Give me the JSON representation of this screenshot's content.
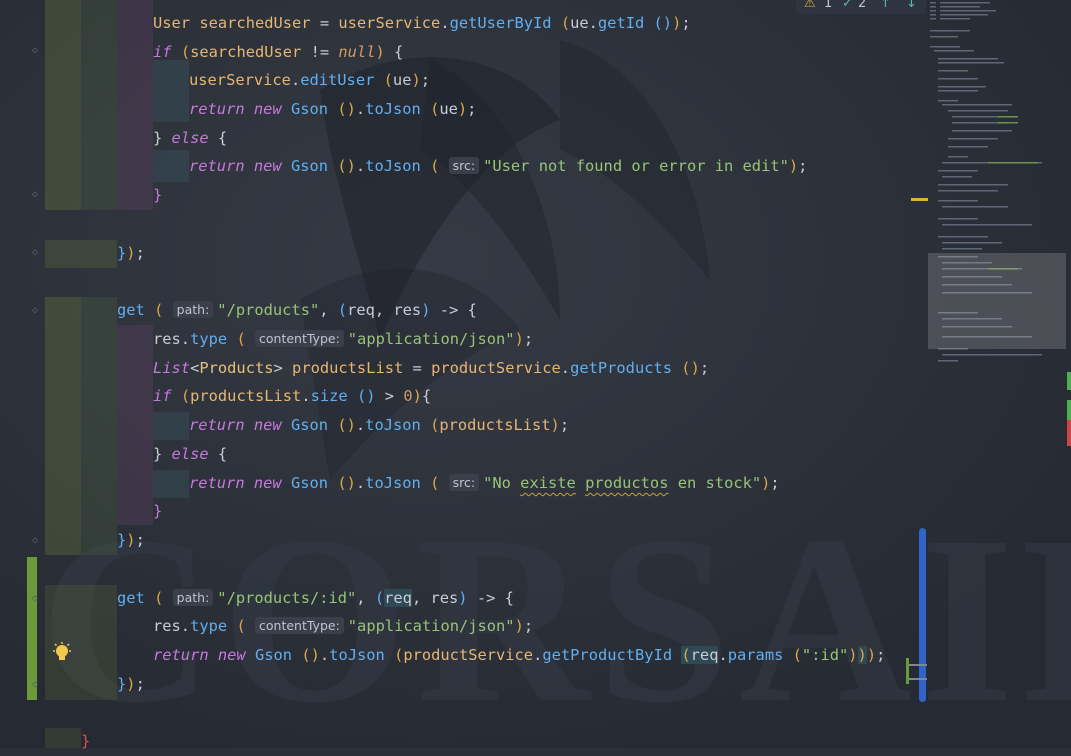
{
  "editor": {
    "inspections": {
      "warnings_count": "1",
      "weak_warnings_count": "2"
    },
    "lines": [
      {
        "tokens": [
          [
            "var",
            "User"
          ],
          [
            "p",
            " "
          ],
          [
            "var",
            "searchedUser"
          ],
          [
            "p",
            " = "
          ],
          [
            "var",
            "userService"
          ],
          [
            "p",
            "."
          ],
          [
            "fn",
            "getUserById"
          ],
          [
            "p",
            " "
          ],
          [
            "bp",
            "("
          ],
          [
            "p",
            "ue."
          ],
          [
            "fn",
            "getId"
          ],
          [
            "p",
            " "
          ],
          [
            "bb",
            "()"
          ],
          [
            "bp",
            ")"
          ],
          [
            "p",
            ";"
          ]
        ]
      },
      {
        "tokens": [
          [
            "kw",
            "if"
          ],
          [
            "p",
            " "
          ],
          [
            "bp",
            "("
          ],
          [
            "var",
            "searchedUser"
          ],
          [
            "p",
            " != "
          ],
          [
            "null",
            "null"
          ],
          [
            "bp",
            ")"
          ],
          [
            "p",
            " {"
          ]
        ]
      },
      {
        "tokens": [
          [
            "var",
            "userService"
          ],
          [
            "p",
            "."
          ],
          [
            "fn",
            "editUser"
          ],
          [
            "p",
            " "
          ],
          [
            "bp",
            "("
          ],
          [
            "p",
            "ue"
          ],
          [
            "bp",
            ")"
          ],
          [
            "p",
            ";"
          ]
        ]
      },
      {
        "tokens": [
          [
            "kw",
            "return"
          ],
          [
            "p",
            " "
          ],
          [
            "kwn",
            "new"
          ],
          [
            "p",
            " "
          ],
          [
            "fn",
            "Gson"
          ],
          [
            "p",
            " "
          ],
          [
            "bp",
            "()"
          ],
          [
            "p",
            "."
          ],
          [
            "fn",
            "toJson"
          ],
          [
            "p",
            " "
          ],
          [
            "bp",
            "("
          ],
          [
            "p",
            "ue"
          ],
          [
            "bp",
            ")"
          ],
          [
            "p",
            ";"
          ]
        ]
      },
      {
        "tokens": [
          [
            "p",
            "} "
          ],
          [
            "kw",
            "else"
          ],
          [
            "p",
            " {"
          ]
        ]
      },
      {
        "tokens": [
          [
            "kw",
            "return"
          ],
          [
            "p",
            " "
          ],
          [
            "kwn",
            "new"
          ],
          [
            "p",
            " "
          ],
          [
            "fn",
            "Gson"
          ],
          [
            "p",
            " "
          ],
          [
            "bp",
            "()"
          ],
          [
            "p",
            "."
          ],
          [
            "fn",
            "toJson"
          ],
          [
            "p",
            " "
          ],
          [
            "bp",
            "("
          ],
          [
            "p",
            " "
          ],
          [
            "hint",
            "src:"
          ],
          [
            "str",
            "\"User not found or error in edit\""
          ],
          [
            "bp",
            ")"
          ],
          [
            "p",
            ";"
          ]
        ]
      },
      {
        "tokens": [
          [
            "bpk",
            "}"
          ]
        ]
      },
      {
        "tokens": []
      },
      {
        "tokens": [
          [
            "bb",
            "}"
          ],
          [
            "bp",
            ")"
          ],
          [
            "p",
            ";"
          ]
        ]
      },
      {
        "tokens": []
      },
      {
        "tokens": [
          [
            "fn",
            "get"
          ],
          [
            "p",
            " "
          ],
          [
            "bp",
            "("
          ],
          [
            "p",
            " "
          ],
          [
            "hint",
            "path:"
          ],
          [
            "str",
            "\"/products\""
          ],
          [
            "p",
            ", "
          ],
          [
            "bb",
            "("
          ],
          [
            "p",
            "req, res"
          ],
          [
            "bb",
            ")"
          ],
          [
            "p",
            " -> {"
          ]
        ]
      },
      {
        "tokens": [
          [
            "p",
            "res."
          ],
          [
            "fn",
            "type"
          ],
          [
            "p",
            " "
          ],
          [
            "bp",
            "("
          ],
          [
            "p",
            " "
          ],
          [
            "hint",
            "contentType:"
          ],
          [
            "str",
            "\"application/json\""
          ],
          [
            "bp",
            ")"
          ],
          [
            "p",
            ";"
          ]
        ]
      },
      {
        "tokens": [
          [
            "kw",
            "List"
          ],
          [
            "p",
            "<"
          ],
          [
            "ty",
            "Products"
          ],
          [
            "p",
            "> "
          ],
          [
            "var",
            "productsList"
          ],
          [
            "p",
            " = "
          ],
          [
            "var",
            "productService"
          ],
          [
            "p",
            "."
          ],
          [
            "fn",
            "getProducts"
          ],
          [
            "p",
            " "
          ],
          [
            "bp",
            "()"
          ],
          [
            "p",
            ";"
          ]
        ]
      },
      {
        "tokens": [
          [
            "kw",
            "if"
          ],
          [
            "p",
            " "
          ],
          [
            "bp",
            "("
          ],
          [
            "var",
            "productsList"
          ],
          [
            "p",
            "."
          ],
          [
            "fn",
            "size"
          ],
          [
            "p",
            " "
          ],
          [
            "bb",
            "()"
          ],
          [
            "p",
            " > "
          ],
          [
            "num",
            "0"
          ],
          [
            "bp",
            ")"
          ],
          [
            "p",
            "{"
          ]
        ]
      },
      {
        "tokens": [
          [
            "kw",
            "return"
          ],
          [
            "p",
            " "
          ],
          [
            "kwn",
            "new"
          ],
          [
            "p",
            " "
          ],
          [
            "fn",
            "Gson"
          ],
          [
            "p",
            " "
          ],
          [
            "bp",
            "()"
          ],
          [
            "p",
            "."
          ],
          [
            "fn",
            "toJson"
          ],
          [
            "p",
            " "
          ],
          [
            "bp",
            "("
          ],
          [
            "var",
            "productsList"
          ],
          [
            "bp",
            ")"
          ],
          [
            "p",
            ";"
          ]
        ]
      },
      {
        "tokens": [
          [
            "p",
            "} "
          ],
          [
            "kw",
            "else"
          ],
          [
            "p",
            " {"
          ]
        ]
      },
      {
        "tokens": [
          [
            "kw",
            "return"
          ],
          [
            "p",
            " "
          ],
          [
            "kwn",
            "new"
          ],
          [
            "p",
            " "
          ],
          [
            "fn",
            "Gson"
          ],
          [
            "p",
            " "
          ],
          [
            "bp",
            "()"
          ],
          [
            "p",
            "."
          ],
          [
            "fn",
            "toJson"
          ],
          [
            "p",
            " "
          ],
          [
            "bp",
            "("
          ],
          [
            "p",
            " "
          ],
          [
            "hint",
            "src:"
          ],
          [
            "str",
            "\"No "
          ],
          [
            "sq",
            "existe"
          ],
          [
            "str",
            " "
          ],
          [
            "sq",
            "productos"
          ],
          [
            "str",
            " en stock\""
          ],
          [
            "bp",
            ")"
          ],
          [
            "p",
            ";"
          ]
        ]
      },
      {
        "tokens": [
          [
            "bpk",
            "}"
          ]
        ]
      },
      {
        "tokens": [
          [
            "bb",
            "}"
          ],
          [
            "bp",
            ")"
          ],
          [
            "p",
            ";"
          ]
        ]
      },
      {
        "tokens": []
      },
      {
        "tokens": [
          [
            "fn",
            "get"
          ],
          [
            "p",
            " "
          ],
          [
            "bp",
            "("
          ],
          [
            "p",
            " "
          ],
          [
            "hint",
            "path:"
          ],
          [
            "str",
            "\"/products/:id\""
          ],
          [
            "p",
            ", "
          ],
          [
            "bb",
            "("
          ],
          [
            "hl",
            "req"
          ],
          [
            "p",
            ", res"
          ],
          [
            "bb",
            ")"
          ],
          [
            "p",
            " -> {"
          ]
        ]
      },
      {
        "tokens": [
          [
            "p",
            "res."
          ],
          [
            "fn",
            "type"
          ],
          [
            "p",
            " "
          ],
          [
            "bp",
            "("
          ],
          [
            "p",
            " "
          ],
          [
            "hint",
            "contentType:"
          ],
          [
            "str",
            "\"application/json\""
          ],
          [
            "bp",
            ")"
          ],
          [
            "p",
            ";"
          ]
        ]
      },
      {
        "tokens": [
          [
            "kw",
            "return"
          ],
          [
            "p",
            " "
          ],
          [
            "kwn",
            "new"
          ],
          [
            "p",
            " "
          ],
          [
            "fn",
            "Gson"
          ],
          [
            "p",
            " "
          ],
          [
            "bp",
            "()"
          ],
          [
            "p",
            "."
          ],
          [
            "fn",
            "toJson"
          ],
          [
            "p",
            " "
          ],
          [
            "bp",
            "("
          ],
          [
            "var",
            "productService"
          ],
          [
            "p",
            "."
          ],
          [
            "fn",
            "getProductById"
          ],
          [
            "p",
            " "
          ],
          [
            "hlb",
            "("
          ],
          [
            "hl",
            "req"
          ],
          [
            "p",
            "."
          ],
          [
            "fn",
            "params"
          ],
          [
            "p",
            " "
          ],
          [
            "bp",
            "("
          ],
          [
            "str",
            "\":id\""
          ],
          [
            "bp",
            ")"
          ],
          [
            "hlb",
            ")"
          ],
          [
            "bp",
            ")"
          ],
          [
            "p",
            ";"
          ]
        ]
      },
      {
        "tokens": [
          [
            "bb",
            "}"
          ],
          [
            "bp",
            ")"
          ],
          [
            "p",
            ";"
          ]
        ]
      },
      {
        "tokens": []
      },
      {
        "tokens": [
          [
            "kwr",
            "}"
          ]
        ]
      }
    ]
  },
  "colors": {
    "background": "#2b2f38",
    "accent_scroll": "#2f64c9",
    "change_marker": "#6a9a3a"
  }
}
